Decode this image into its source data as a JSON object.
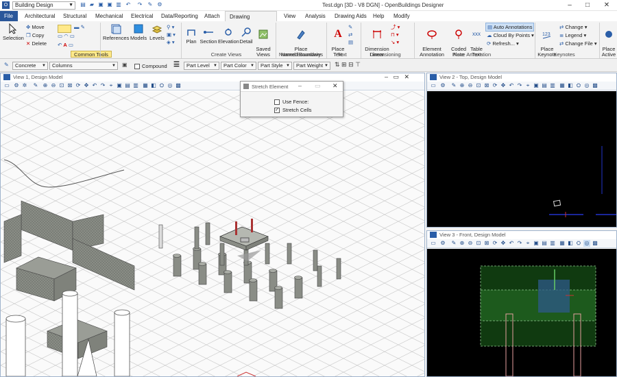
{
  "app": {
    "workspace_select": "Building Design",
    "window_title": "Test.dgn [3D - V8 DGN] - OpenBuildings Designer"
  },
  "tabs": [
    "File",
    "Architectural",
    "Structural",
    "Mechanical",
    "Electrical",
    "Data/Reporting",
    "Attach",
    "Drawing Production",
    "View",
    "Analysis",
    "Drawing Aids",
    "Help",
    "Modify"
  ],
  "active_tab": "Drawing Production",
  "ribbon": {
    "selection": "Selection",
    "move": "Move",
    "copy": "Copy",
    "delete": "Delete",
    "common_tools": "Common Tools",
    "references": "References",
    "models": "Models",
    "levels": "Levels",
    "plan": "Plan",
    "section": "Section",
    "elevation": "Elevation",
    "detail": "Detail",
    "saved_views": "Saved\nViews",
    "create_views": "Create Views",
    "place_named_boundary": "Place\nNamed Boundary",
    "named_boundaries": "Named Boundaries",
    "place_text": "Place\nText",
    "text_group": "Text",
    "dimension_linear": "Dimension\nLinear",
    "dimensioning": "Dimensioning",
    "element_annotation": "Element\nAnnotation",
    "coded_note": "Coded\nNote",
    "table_text": "Table\nText",
    "auto_annotations": "Auto Annotations",
    "cloud_by_points": "Cloud By Points",
    "refresh": "Refresh...",
    "place_annotation": "Place Annotation",
    "place_keynote": "Place\nKeynote",
    "change": "Change",
    "legend": "Legend",
    "change_file": "Change File",
    "keynotes": "Keynotes",
    "place_active": "Place\nActive"
  },
  "attributes": {
    "family": "Concrete",
    "part": "Columns",
    "compound": "Compound",
    "part_level": "Part Level",
    "part_color": "Part Color",
    "part_style": "Part Style",
    "part_weight": "Part Weight"
  },
  "views": {
    "v1": "View 1, Design Model",
    "v2": "View 2 - Top, Design Model",
    "v3": "View 3 - Front, Design Model"
  },
  "dialog": {
    "title": "Stretch Element",
    "use_fence": "Use Fence:",
    "use_fence_checked": false,
    "stretch_cells": "Stretch Cells",
    "stretch_cells_checked": true
  },
  "colors": {
    "file_tab": "#2b579a",
    "view_bg_dark": "#000000",
    "common_tools_highlight": "#ffe98a"
  }
}
